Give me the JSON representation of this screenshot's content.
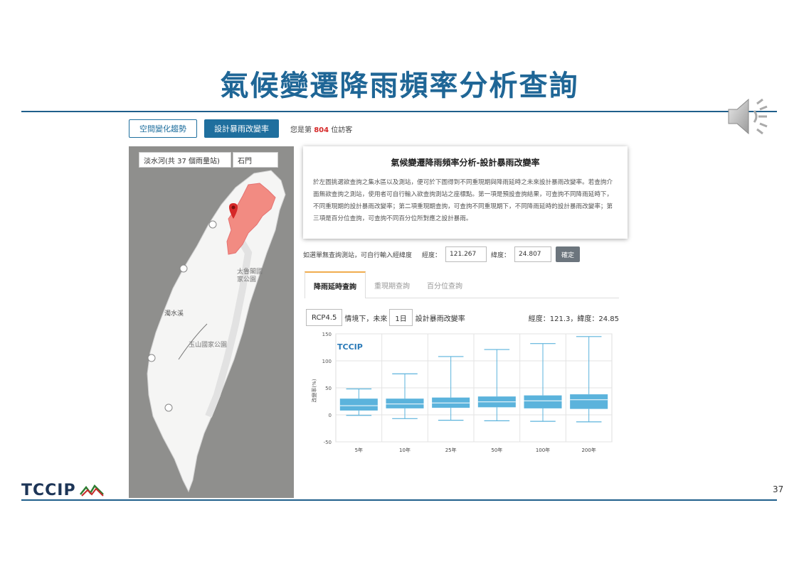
{
  "slide": {
    "title": "氣候變遷降雨頻率分析查詢",
    "page_number": "37",
    "footer_logo_text": "TCCIP"
  },
  "nav": {
    "btn_spatial": "空間變化趨勢",
    "btn_design": "設計暴雨改變率",
    "visitor_prefix": "您是第",
    "visitor_count": "804",
    "visitor_suffix": "位訪客"
  },
  "map": {
    "watershed_select": "淡水河(共 37 個雨量站)",
    "station_select": "石門",
    "labels": {
      "taroko": "太魯閣國家公園",
      "zhuoshui": "濁水溪",
      "yushan": "玉山國家公園"
    },
    "highlight_color": "#f28b82",
    "marker_color": "#d62828"
  },
  "info_card": {
    "title": "氣候變遷降雨頻率分析-設計暴雨改變率",
    "body": "於左圖挑選欲查詢之集水區以及測站，便可於下圖得到不同重現期與降雨延時之未來設計暴雨改變率。若查詢介面無欲查詢之測站，使用者可自行輸入欲查詢測站之座標點。第一項是預設查詢結果，可查詢不同降雨延時下，不同重現期的設計暴雨改變率；第二項重現期查詢，可查詢不同重現期下，不同降雨延時的設計暴雨改變率；第三項是百分位查詢，可查詢不同百分位所對應之設計暴雨。"
  },
  "coord_entry": {
    "prompt": "如選單無查詢測站，可自行輸入經緯度",
    "lon_label": "經度：",
    "lon_value": "121.267",
    "lat_label": "緯度：",
    "lat_value": "24.807",
    "confirm": "確定"
  },
  "tabs": [
    {
      "label": "降雨延時查詢",
      "active": true
    },
    {
      "label": "重現期查詢",
      "active": false
    },
    {
      "label": "百分位查詢",
      "active": false
    }
  ],
  "scenario": {
    "rcp": "RCP4.5",
    "text1": "情境下，未來",
    "duration": "1日",
    "text2": "設計暴雨改變率",
    "coord_readout": "經度：121.3，緯度：24.85"
  },
  "chart_data": {
    "type": "box",
    "watermark": "TCCIP",
    "ylabel": "改變率(%)",
    "ylim": [
      -50,
      150
    ],
    "yticks": [
      -50,
      0,
      50,
      100,
      150
    ],
    "categories": [
      "5年",
      "10年",
      "25年",
      "50年",
      "100年",
      "200年"
    ],
    "box_color": "#5bb3dc",
    "boxes": [
      {
        "min": -1,
        "q1": 8,
        "median": 17,
        "q3": 30,
        "max": 48
      },
      {
        "min": -7,
        "q1": 12,
        "median": 20,
        "q3": 30,
        "max": 76
      },
      {
        "min": -10,
        "q1": 13,
        "median": 22,
        "q3": 32,
        "max": 108
      },
      {
        "min": -11,
        "q1": 14,
        "median": 24,
        "q3": 34,
        "max": 121
      },
      {
        "min": -12,
        "q1": 12,
        "median": 26,
        "q3": 36,
        "max": 132
      },
      {
        "min": -13,
        "q1": 11,
        "median": 28,
        "q3": 38,
        "max": 145
      }
    ]
  }
}
